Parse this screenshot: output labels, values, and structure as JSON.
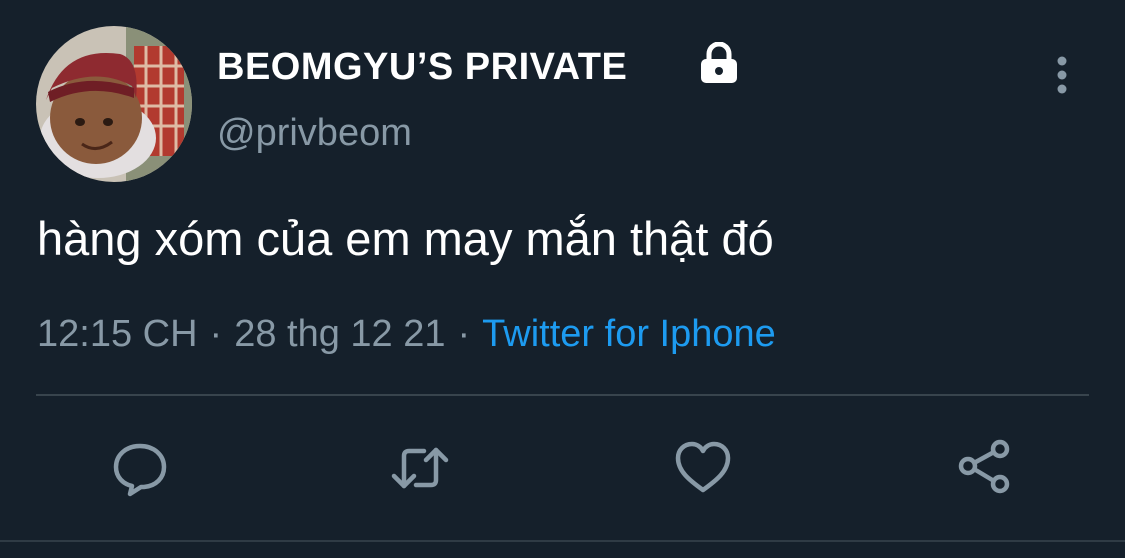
{
  "tweet": {
    "display_name": "BEOMGYU’S PRIVATE",
    "handle": "@privbeom",
    "text": "hàng xóm của em may mắn thật đó",
    "time": "12:15 CH",
    "date": "28 thg 12 21",
    "separator": "·",
    "source": "Twitter for Iphone",
    "protected": true
  },
  "icons": {
    "lock": "lock-icon",
    "more": "more-vertical-icon",
    "reply": "reply-icon",
    "retweet": "retweet-icon",
    "like": "heart-icon",
    "share": "share-icon"
  },
  "colors": {
    "background": "#15202b",
    "text_primary": "#ffffff",
    "text_secondary": "#8899a6",
    "link": "#1d9bf0",
    "divider": "#38444d"
  }
}
